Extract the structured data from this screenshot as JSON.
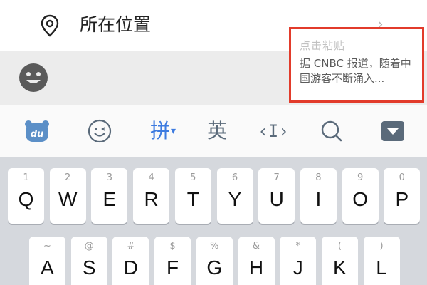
{
  "location": {
    "label": "所在位置",
    "chevron": "›"
  },
  "paste_popup": {
    "title": "点击粘贴",
    "text": "据 CNBC 报道，随着中国游客不断涌入..."
  },
  "toolbar": {
    "pinyin_label": "拼",
    "pinyin_caret": "▾",
    "english_label": "英",
    "cursor_label": "‹I›",
    "du_label": "du"
  },
  "keyboard": {
    "row1": [
      {
        "num": "1",
        "letter": "Q"
      },
      {
        "num": "2",
        "letter": "W"
      },
      {
        "num": "3",
        "letter": "E"
      },
      {
        "num": "4",
        "letter": "R"
      },
      {
        "num": "5",
        "letter": "T"
      },
      {
        "num": "6",
        "letter": "Y"
      },
      {
        "num": "7",
        "letter": "U"
      },
      {
        "num": "8",
        "letter": "I"
      },
      {
        "num": "9",
        "letter": "O"
      },
      {
        "num": "0",
        "letter": "P"
      }
    ],
    "row2": [
      {
        "num": "~",
        "letter": "A"
      },
      {
        "num": "@",
        "letter": "S"
      },
      {
        "num": "#",
        "letter": "D"
      },
      {
        "num": "$",
        "letter": "F"
      },
      {
        "num": "%",
        "letter": "G"
      },
      {
        "num": "&",
        "letter": "H"
      },
      {
        "num": "*",
        "letter": "J"
      },
      {
        "num": "(",
        "letter": "K"
      },
      {
        "num": ")",
        "letter": "L"
      }
    ]
  },
  "colors": {
    "accent": "#3d7be0",
    "highlight_border": "#e23b2b",
    "key_bg": "#ffffff",
    "keyboard_bg": "#d5d8dd"
  }
}
